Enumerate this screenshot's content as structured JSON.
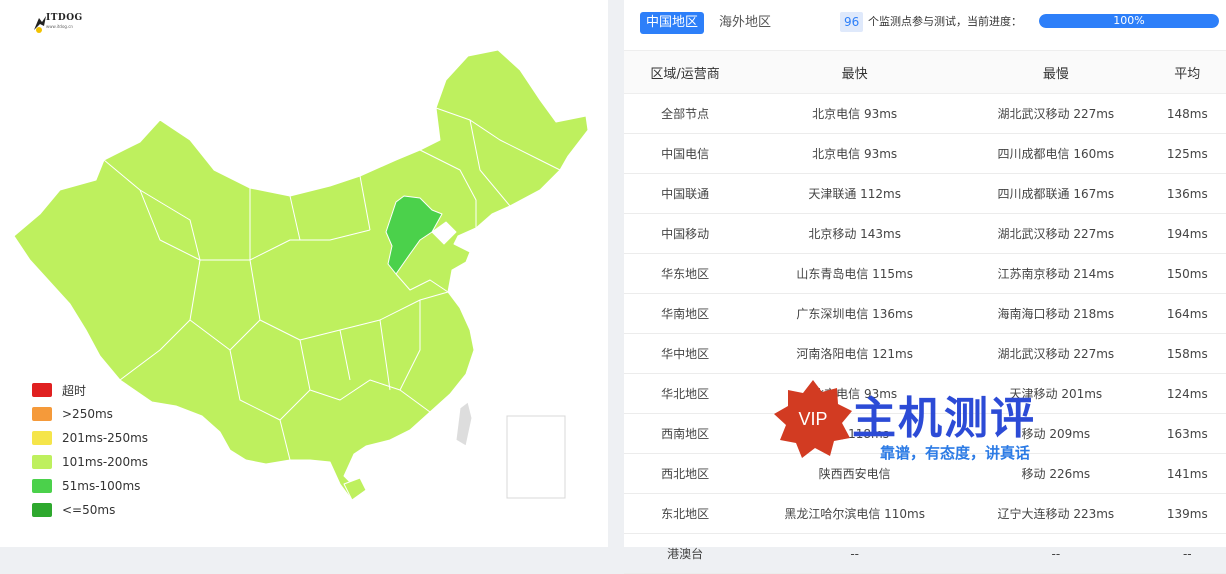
{
  "logo": {
    "text": "ITDOG",
    "sub": "www.itdog.cn"
  },
  "legend": [
    {
      "label": "超时",
      "color": "#e02020"
    },
    {
      "label": ">250ms",
      "color": "#f59a3a"
    },
    {
      "label": "201ms-250ms",
      "color": "#f5e54a"
    },
    {
      "label": "101ms-200ms",
      "color": "#bef05e"
    },
    {
      "label": "51ms-100ms",
      "color": "#4bd14b"
    },
    {
      "label": "<=50ms",
      "color": "#2ea82e"
    }
  ],
  "tabs": {
    "active": "中国地区",
    "inactive": "海外地区"
  },
  "count": {
    "value": "96",
    "text": "个监测点参与测试，当前进度："
  },
  "progress": {
    "percent": 100,
    "label": "100%"
  },
  "table": {
    "headers": [
      "区域/运营商",
      "最快",
      "最慢",
      "平均"
    ],
    "rows": [
      [
        "全部节点",
        "北京电信 93ms",
        "湖北武汉移动 227ms",
        "148ms"
      ],
      [
        "中国电信",
        "北京电信 93ms",
        "四川成都电信 160ms",
        "125ms"
      ],
      [
        "中国联通",
        "天津联通 112ms",
        "四川成都联通 167ms",
        "136ms"
      ],
      [
        "中国移动",
        "北京移动 143ms",
        "湖北武汉移动 227ms",
        "194ms"
      ],
      [
        "华东地区",
        "山东青岛电信 115ms",
        "江苏南京移动 214ms",
        "150ms"
      ],
      [
        "华南地区",
        "广东深圳电信 136ms",
        "海南海口移动 218ms",
        "164ms"
      ],
      [
        "华中地区",
        "河南洛阳电信 121ms",
        "湖北武汉移动 227ms",
        "158ms"
      ],
      [
        "华北地区",
        "北京电信 93ms",
        "天津移动 201ms",
        "124ms"
      ],
      [
        "西南地区",
        "电信 118ms",
        "移动 209ms",
        "163ms"
      ],
      [
        "西北地区",
        "陕西西安电信",
        "移动 226ms",
        "141ms"
      ],
      [
        "东北地区",
        "黑龙江哈尔滨电信 110ms",
        "辽宁大连移动 223ms",
        "139ms"
      ],
      [
        "港澳台",
        "--",
        "--",
        "--"
      ]
    ]
  },
  "watermark": {
    "badge": "VIP",
    "title": "主机测评",
    "subtitle": "靠谱，有态度，讲真话"
  },
  "colors": {
    "accent": "#2d7ff9",
    "map_main": "#bef05e",
    "map_highlight": "#4bd14b"
  }
}
